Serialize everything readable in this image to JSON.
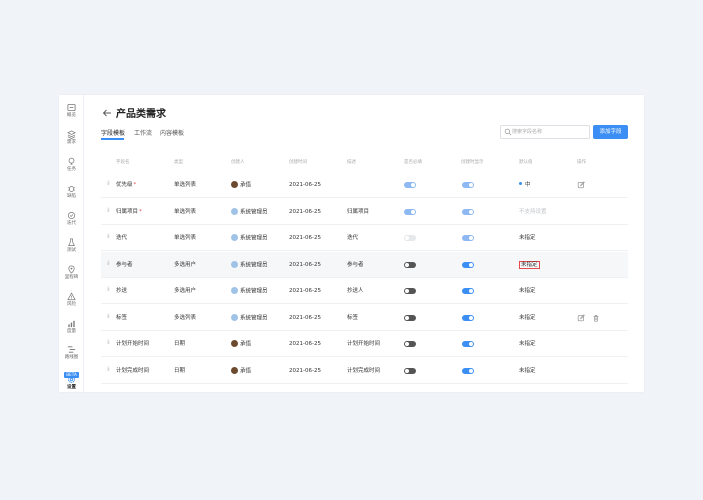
{
  "sidebar": {
    "items": [
      {
        "label": "概览",
        "icon": "overview-icon"
      },
      {
        "label": "需求",
        "icon": "layers-icon"
      },
      {
        "label": "任务",
        "icon": "bulb-icon"
      },
      {
        "label": "缺陷",
        "icon": "bug-icon"
      },
      {
        "label": "迭代",
        "icon": "cycle-icon"
      },
      {
        "label": "测试",
        "icon": "flask-icon"
      },
      {
        "label": "里程碑",
        "icon": "location-icon"
      },
      {
        "label": "风险",
        "icon": "warning-icon"
      },
      {
        "label": "度量",
        "icon": "chart-icon"
      },
      {
        "label": "路线图",
        "icon": "roadmap-icon",
        "badge": "BETA"
      },
      {
        "label": "设置",
        "icon": "gear-icon",
        "active": true
      }
    ]
  },
  "header": {
    "back_icon": "arrow-left-icon",
    "title": "产品类需求"
  },
  "tabs": [
    {
      "label": "字段模板",
      "active": true
    },
    {
      "label": "工作流"
    },
    {
      "label": "内容模板"
    }
  ],
  "search": {
    "placeholder": "搜索字段名称",
    "value": ""
  },
  "add_button": "添加字段",
  "colors": {
    "accent": "#3b8ef3",
    "required": "#e5484d"
  },
  "table": {
    "columns": [
      "字段名",
      "类型",
      "创建人",
      "创建时间",
      "描述",
      "是否必填",
      "创建时显示",
      "默认值",
      "操作"
    ],
    "rows": [
      {
        "name": "优先级",
        "required": true,
        "type": "单选列表",
        "creator": "承悟",
        "avatar": "person",
        "date": "2021-06-25",
        "desc": "",
        "req_toggle": "on",
        "show_toggle": "on",
        "default": "中",
        "default_style": "dot",
        "actions": [
          "edit-icon"
        ]
      },
      {
        "name": "归属项目",
        "required": true,
        "type": "单选列表",
        "creator": "系统管理员",
        "avatar": "sys",
        "date": "2021-06-25",
        "desc": "归属项目",
        "req_toggle": "on",
        "show_toggle": "on",
        "default": "不支持设置",
        "default_style": "muted",
        "actions": []
      },
      {
        "name": "迭代",
        "required": false,
        "type": "单选列表",
        "creator": "系统管理员",
        "avatar": "sys",
        "date": "2021-06-25",
        "desc": "迭代",
        "req_toggle": "dis",
        "show_toggle": "on",
        "default": "未指定",
        "default_style": "",
        "actions": []
      },
      {
        "name": "参与者",
        "required": false,
        "type": "多选用户",
        "creator": "系统管理员",
        "avatar": "sys",
        "date": "2021-06-25",
        "desc": "参与者",
        "req_toggle": "off",
        "show_toggle": "on2",
        "default": "未指定",
        "default_style": "boxed",
        "actions": [],
        "highlight": true
      },
      {
        "name": "抄送",
        "required": false,
        "type": "多选用户",
        "creator": "系统管理员",
        "avatar": "sys",
        "date": "2021-06-25",
        "desc": "抄送人",
        "req_toggle": "off",
        "show_toggle": "on2",
        "default": "未指定",
        "default_style": "",
        "actions": []
      },
      {
        "name": "标签",
        "required": false,
        "type": "多选列表",
        "creator": "系统管理员",
        "avatar": "sys",
        "date": "2021-06-25",
        "desc": "标签",
        "req_toggle": "off",
        "show_toggle": "on2",
        "default": "未指定",
        "default_style": "",
        "actions": [
          "edit-icon",
          "trash-icon"
        ]
      },
      {
        "name": "计划开始时间",
        "required": false,
        "type": "日期",
        "creator": "承悟",
        "avatar": "person",
        "date": "2021-06-25",
        "desc": "计划开始时间",
        "req_toggle": "off",
        "show_toggle": "on2",
        "default": "未指定",
        "default_style": "",
        "actions": []
      },
      {
        "name": "计划完成时间",
        "required": false,
        "type": "日期",
        "creator": "承悟",
        "avatar": "person",
        "date": "2021-06-25",
        "desc": "计划完成时间",
        "req_toggle": "off",
        "show_toggle": "on2",
        "default": "未指定",
        "default_style": "",
        "actions": []
      }
    ]
  }
}
